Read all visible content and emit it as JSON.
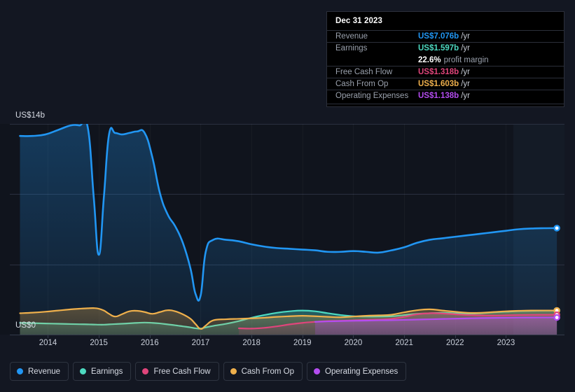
{
  "chart_data": {
    "type": "area",
    "title": "",
    "xlabel": "",
    "ylabel": "",
    "ylim": [
      0,
      14
    ],
    "y_axis": {
      "top_label": "US$14b",
      "bottom_label": "US$0",
      "unit": "US$b",
      "gridlines": [
        0,
        4.667,
        9.333,
        14
      ]
    },
    "x_axis": {
      "tick_labels": [
        "2014",
        "2015",
        "2016",
        "2017",
        "2018",
        "2019",
        "2020",
        "2021",
        "2022",
        "2023"
      ],
      "range": [
        "2013-06",
        "2024-03"
      ]
    },
    "grid": true,
    "legend_position": "bottom-left",
    "x": [
      2013.45,
      2013.7,
      2013.95,
      2014.2,
      2014.45,
      2014.62,
      2014.78,
      2014.9,
      2015.0,
      2015.1,
      2015.2,
      2015.32,
      2015.45,
      2015.6,
      2015.75,
      2015.9,
      2016.05,
      2016.2,
      2016.35,
      2016.5,
      2016.65,
      2016.8,
      2016.9,
      2017.0,
      2017.1,
      2017.25,
      2017.5,
      2017.75,
      2018.0,
      2018.25,
      2018.5,
      2018.75,
      2019.0,
      2019.25,
      2019.5,
      2019.75,
      2020.0,
      2020.25,
      2020.5,
      2020.75,
      2021.0,
      2021.25,
      2021.5,
      2021.75,
      2022.0,
      2022.25,
      2022.5,
      2022.75,
      2023.0,
      2023.25,
      2023.5,
      2023.75,
      2024.0
    ],
    "series": [
      {
        "name": "Revenue",
        "color": "#2196f3",
        "values": [
          13.2,
          13.2,
          13.3,
          13.6,
          13.9,
          13.9,
          13.8,
          9.1,
          5.3,
          9.2,
          13.3,
          13.4,
          13.3,
          13.4,
          13.5,
          13.4,
          11.8,
          9.4,
          8.0,
          7.2,
          6.1,
          4.4,
          2.7,
          2.6,
          5.5,
          6.3,
          6.3,
          6.2,
          6.0,
          5.85,
          5.75,
          5.7,
          5.65,
          5.6,
          5.5,
          5.5,
          5.55,
          5.5,
          5.45,
          5.6,
          5.8,
          6.1,
          6.3,
          6.4,
          6.5,
          6.6,
          6.7,
          6.8,
          6.9,
          7.0,
          7.05,
          7.07,
          7.076
        ]
      },
      {
        "name": "Earnings",
        "color": "#4dd9c0",
        "values": [
          0.78,
          0.76,
          0.74,
          0.72,
          0.7,
          0.69,
          0.68,
          0.67,
          0.66,
          0.66,
          0.68,
          0.7,
          0.72,
          0.75,
          0.78,
          0.8,
          0.78,
          0.74,
          0.68,
          0.62,
          0.55,
          0.48,
          0.42,
          0.4,
          0.48,
          0.58,
          0.72,
          0.9,
          1.12,
          1.3,
          1.45,
          1.55,
          1.6,
          1.55,
          1.42,
          1.3,
          1.22,
          1.2,
          1.2,
          1.22,
          1.3,
          1.38,
          1.42,
          1.45,
          1.42,
          1.4,
          1.42,
          1.48,
          1.52,
          1.56,
          1.58,
          1.59,
          1.597
        ]
      },
      {
        "name": "Free Cash Flow",
        "color": "#e0457b",
        "values": [
          null,
          null,
          null,
          null,
          null,
          null,
          null,
          null,
          null,
          null,
          null,
          null,
          null,
          null,
          null,
          null,
          null,
          null,
          null,
          null,
          null,
          null,
          null,
          null,
          null,
          null,
          null,
          0.42,
          0.4,
          0.45,
          0.55,
          0.68,
          0.78,
          0.85,
          0.9,
          0.92,
          0.95,
          0.98,
          1.0,
          1.05,
          1.18,
          1.35,
          1.42,
          1.4,
          1.35,
          1.3,
          1.28,
          1.26,
          1.28,
          1.3,
          1.31,
          1.315,
          1.318
        ]
      },
      {
        "name": "Cash From Op",
        "color": "#efb04c",
        "values": [
          1.42,
          1.46,
          1.52,
          1.6,
          1.68,
          1.72,
          1.75,
          1.76,
          1.72,
          1.6,
          1.38,
          1.2,
          1.35,
          1.55,
          1.58,
          1.5,
          1.38,
          1.5,
          1.62,
          1.55,
          1.35,
          1.05,
          0.7,
          0.38,
          0.6,
          0.95,
          1.02,
          1.05,
          1.08,
          1.12,
          1.18,
          1.22,
          1.25,
          1.22,
          1.18,
          1.15,
          1.2,
          1.25,
          1.28,
          1.32,
          1.48,
          1.62,
          1.68,
          1.6,
          1.52,
          1.45,
          1.45,
          1.5,
          1.55,
          1.58,
          1.6,
          1.602,
          1.603
        ]
      },
      {
        "name": "Operating Expenses",
        "color": "#b44df0",
        "values": [
          null,
          null,
          null,
          null,
          null,
          null,
          null,
          null,
          null,
          null,
          null,
          null,
          null,
          null,
          null,
          null,
          null,
          null,
          null,
          null,
          null,
          null,
          null,
          null,
          null,
          null,
          null,
          null,
          null,
          null,
          null,
          null,
          null,
          0.85,
          0.88,
          0.9,
          0.92,
          0.93,
          0.95,
          0.96,
          0.98,
          1.0,
          1.02,
          1.04,
          1.06,
          1.08,
          1.1,
          1.11,
          1.12,
          1.13,
          1.135,
          1.137,
          1.138
        ]
      }
    ]
  },
  "tooltip": {
    "date": "Dec 31 2023",
    "rows": [
      {
        "label": "Revenue",
        "value": "US$7.076b",
        "suffix": "/yr",
        "color": "#2196f3"
      },
      {
        "label": "Earnings",
        "value": "US$1.597b",
        "suffix": "/yr",
        "color": "#4dd9c0"
      },
      {
        "label": "Free Cash Flow",
        "value": "US$1.318b",
        "suffix": "/yr",
        "color": "#e0457b"
      },
      {
        "label": "Cash From Op",
        "value": "US$1.603b",
        "suffix": "/yr",
        "color": "#efb04c"
      },
      {
        "label": "Operating Expenses",
        "value": "US$1.138b",
        "suffix": "/yr",
        "color": "#b44df0"
      }
    ],
    "profit_margin": {
      "value": "22.6%",
      "suffix": "profit margin"
    }
  },
  "legend": {
    "items": [
      {
        "label": "Revenue",
        "color": "#2196f3"
      },
      {
        "label": "Earnings",
        "color": "#4dd9c0"
      },
      {
        "label": "Free Cash Flow",
        "color": "#e0457b"
      },
      {
        "label": "Cash From Op",
        "color": "#efb04c"
      },
      {
        "label": "Operating Expenses",
        "color": "#b44df0"
      }
    ]
  },
  "colors": {
    "background": "#131722",
    "plot_past": "#10141d",
    "plot_future": "#141b26",
    "gridline": "#2a3040"
  }
}
